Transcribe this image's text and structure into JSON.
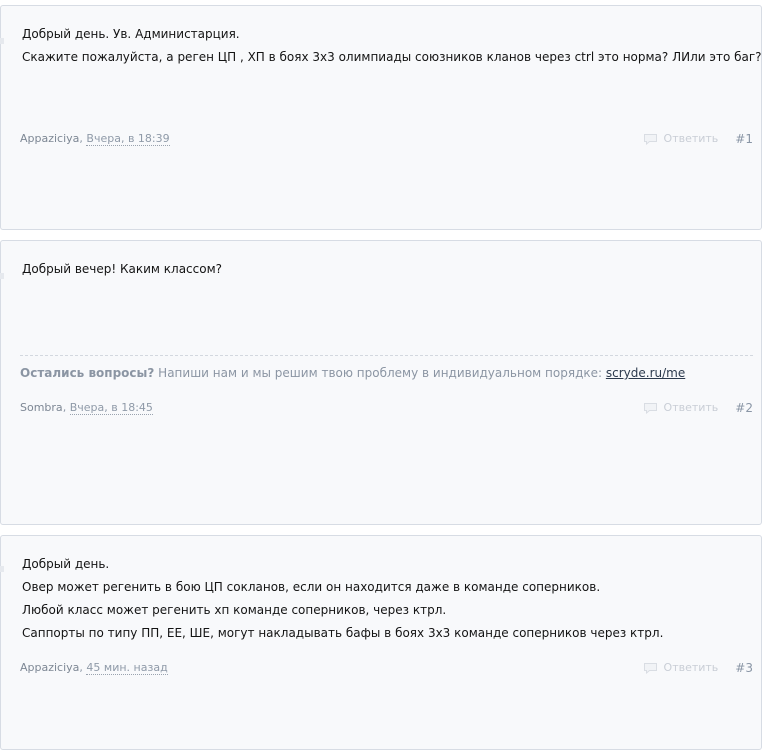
{
  "posts": [
    {
      "lines": [
        "Добрый день. Ув. Администарция.",
        "Скажите пожалуйста, а реген ЦП , ХП в боях 3х3 олимпиады союзников кланов через ctrl это норма? ЛИли это баг?"
      ],
      "author": "Appaziciya",
      "time": "Вчера, в 18:39",
      "reply_label": "Ответить",
      "number": "#1",
      "reply_icon": "speech-bubble-icon"
    },
    {
      "lines": [
        "Добрый вечер! Каким классом?"
      ],
      "signature": {
        "question": "Остались вопросы?",
        "text": "Напиши нам и мы решим твою проблему в индивидуальном порядке:",
        "link": "scryde.ru/me"
      },
      "author": "Sombra",
      "time": "Вчера, в 18:45",
      "reply_label": "Ответить",
      "number": "#2",
      "reply_icon": "speech-bubble-icon"
    },
    {
      "lines": [
        "Добрый день.",
        "Овер может регенить в бою ЦП сокланов, если он находится даже в команде соперников.",
        "Любой класс может регенить хп команде соперников, через ктрл.",
        "Саппорты по типу ПП, ЕЕ, ШЕ, могут накладывать бафы в боях 3х3 команде соперников через ктрл."
      ],
      "author": "Appaziciya",
      "time": "45 мин. назад",
      "reply_label": "Ответить",
      "number": "#3",
      "reply_icon": "speech-bubble-icon"
    }
  ],
  "colors": {
    "post_background": "#f8f9fb",
    "post_border": "#d7dce4",
    "meta_text": "#8f9aa8",
    "reply_text": "#c9ced6",
    "body_text": "#141414"
  }
}
